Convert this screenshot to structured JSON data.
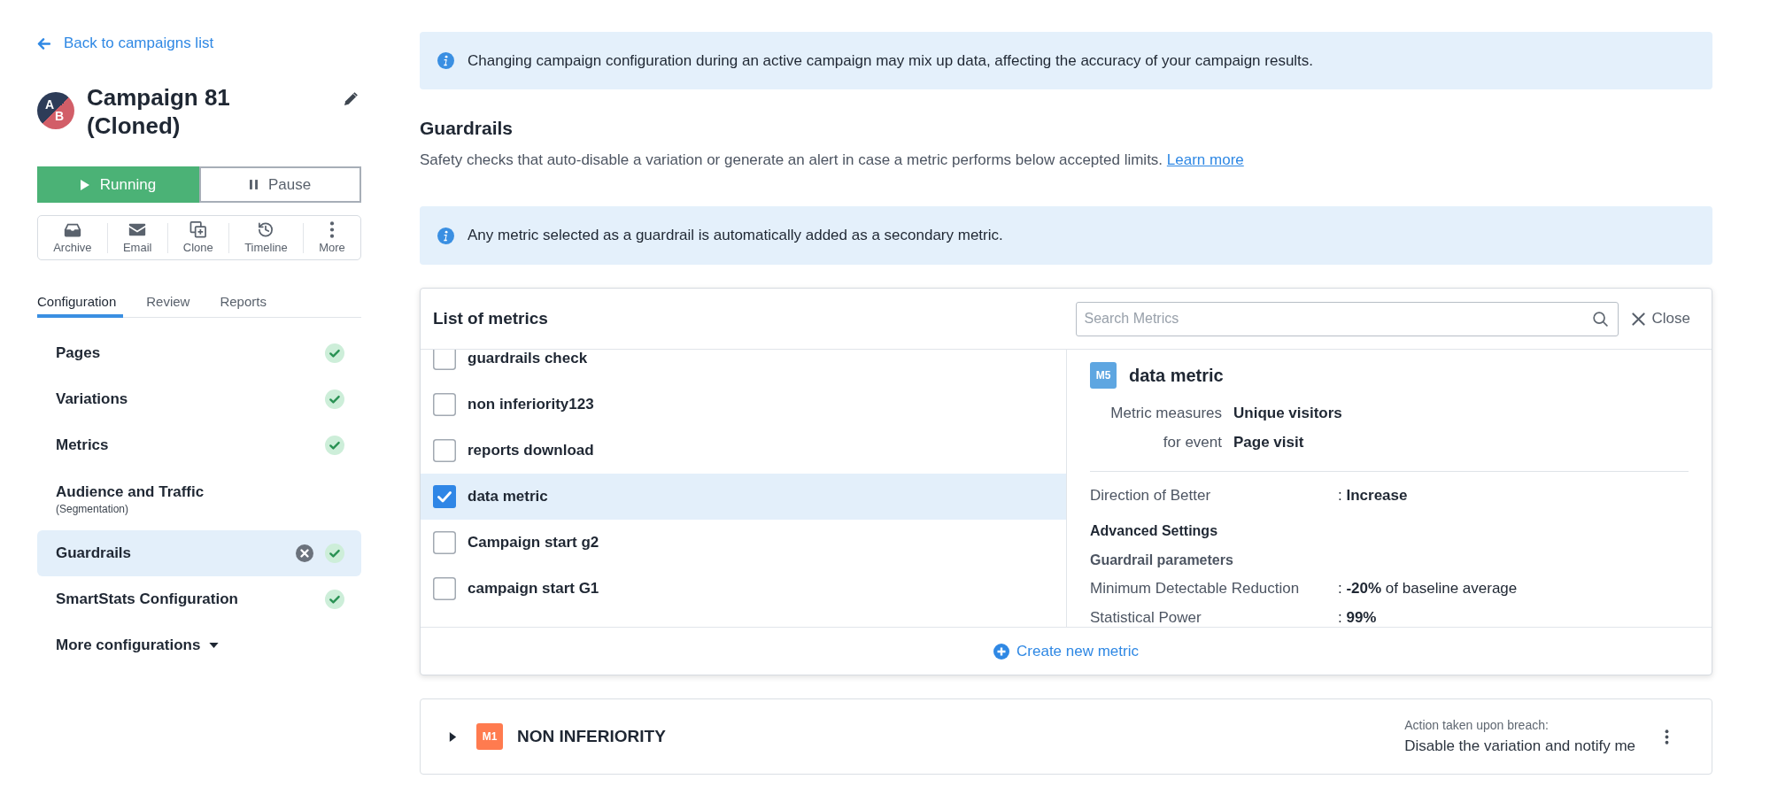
{
  "sidebar": {
    "back_link": "Back to campaigns list",
    "avatar_letters": [
      "A",
      "B"
    ],
    "campaign_title": "Campaign 81 (Cloned)",
    "status_buttons": [
      {
        "label": "Running",
        "selected": true
      },
      {
        "label": "Pause",
        "selected": false
      }
    ],
    "actions": [
      "Archive",
      "Email",
      "Clone",
      "Timeline",
      "More"
    ],
    "tabs": [
      {
        "label": "Configuration",
        "selected": true
      },
      {
        "label": "Review",
        "selected": false
      },
      {
        "label": "Reports",
        "selected": false
      }
    ],
    "nav_items": [
      {
        "label": "Pages",
        "complete": true,
        "selected": false,
        "removable": false
      },
      {
        "label": "Variations",
        "complete": true,
        "selected": false,
        "removable": false
      },
      {
        "label": "Metrics",
        "complete": true,
        "selected": false,
        "removable": false
      },
      {
        "label": "Audience and Traffic",
        "sublabel": "(Segmentation)",
        "complete": false,
        "selected": false,
        "removable": false
      },
      {
        "label": "Guardrails",
        "complete": true,
        "selected": true,
        "removable": true
      },
      {
        "label": "SmartStats Configuration",
        "complete": true,
        "selected": false,
        "removable": false
      }
    ],
    "more_configurations": "More configurations"
  },
  "main": {
    "notice": "Changing campaign configuration during an active campaign may mix up data, affecting the accuracy of your campaign results.",
    "section_title": "Guardrails",
    "section_description": "Safety checks that auto-disable a variation or generate an alert in case a metric performs below accepted limits.",
    "learn_more": "Learn more",
    "info": "Any metric selected as a guardrail is automatically added as a secondary metric.",
    "metrics_panel": {
      "title": "List of metrics",
      "search": {
        "placeholder": "Search Metrics"
      },
      "close": "Close",
      "metrics": [
        {
          "name": "guardrails check",
          "checked": false,
          "selected": false
        },
        {
          "name": "non inferiority123",
          "checked": false,
          "selected": false
        },
        {
          "name": "reports download",
          "checked": false,
          "selected": false
        },
        {
          "name": "data metric",
          "checked": true,
          "selected": true
        },
        {
          "name": "Campaign start g2",
          "checked": false,
          "selected": false
        },
        {
          "name": "campaign start G1",
          "checked": false,
          "selected": false
        }
      ],
      "detail": {
        "badge": "M5",
        "name": "data metric",
        "measures": [
          {
            "label": "Metric measures",
            "value": "Unique visitors"
          },
          {
            "label": "for event",
            "value": "Page visit"
          }
        ],
        "direction": {
          "label": "Direction of Better",
          "value": ": **Increase**"
        },
        "advanced_title": "Advanced Settings",
        "parameters_title": "Guardrail parameters",
        "parameters": [
          {
            "label": "Minimum Detectable Reduction",
            "value": ": **-20%** of baseline average"
          },
          {
            "label": "Statistical Power",
            "value": ": **99%**"
          }
        ]
      },
      "create_button": "Create new metric"
    },
    "guardrails": [
      {
        "badge": "M1",
        "name": "NON INFERIORITY",
        "expanded": false,
        "action_label": "Action taken upon breach:",
        "action": "Disable the variation and notify me"
      }
    ]
  }
}
